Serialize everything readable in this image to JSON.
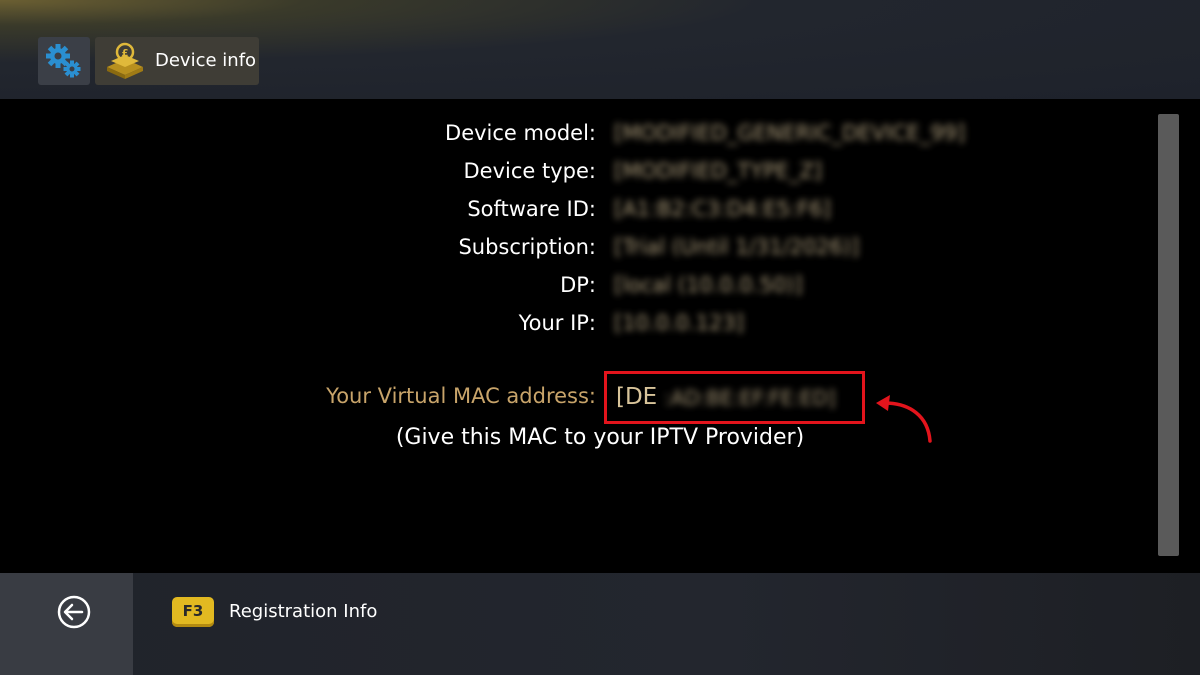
{
  "header": {
    "settings_icon": "gears-icon",
    "tab": {
      "label": "Device info",
      "icon": "device-info-icon"
    }
  },
  "device_info": {
    "rows": [
      {
        "label": "Device model:",
        "value": "[MODIFIED_GENERIC_DEVICE_99]"
      },
      {
        "label": "Device type:",
        "value": "[MODIFIED_TYPE_Z]"
      },
      {
        "label": "Software ID:",
        "value": "[A1:B2:C3:D4:E5:F6]"
      },
      {
        "label": "Subscription:",
        "value": "[Trial (Until 1/31/2026)]"
      },
      {
        "label": "DP:",
        "value": "[local (10.0.0.50)]"
      },
      {
        "label": "Your IP:",
        "value": "[10.0.0.123]"
      }
    ],
    "mac": {
      "label": "Your Virtual MAC address:",
      "visible_prefix": "[DE",
      "blurred_rest": ":AD:BE:EF:FE:ED]",
      "hint": "(Give this MAC to your IPTV Provider)"
    }
  },
  "footer": {
    "back_icon": "back-arrow-icon",
    "key": "F3",
    "key_label": "Registration Info"
  },
  "colors": {
    "highlight_box": "#e3141c",
    "mac_label": "#c8a46a",
    "key_yellow": "#e2b921"
  }
}
